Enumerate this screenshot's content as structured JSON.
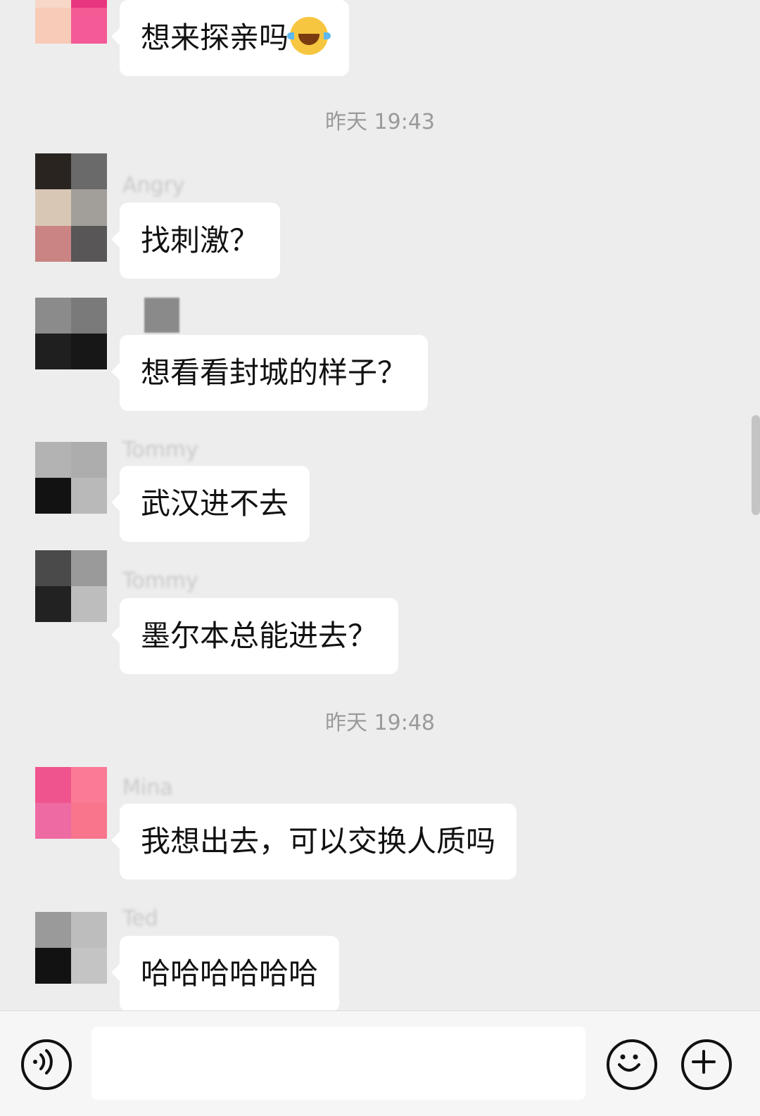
{
  "messages": [
    {
      "sender": "",
      "text": "想来探亲吗",
      "emoji": "tears-of-joy-icon"
    },
    {
      "timestamp": "昨天 19:43"
    },
    {
      "sender": "Angry",
      "text": "找刺激？"
    },
    {
      "sender": "",
      "text": "想看看封城的样子？"
    },
    {
      "sender": "Tommy",
      "text": "武汉进不去"
    },
    {
      "sender": "Tommy",
      "text": "墨尔本总能进去？"
    },
    {
      "timestamp": "昨天 19:48"
    },
    {
      "sender": "Mina",
      "text": "我想出去，可以交换人质吗"
    },
    {
      "sender": "Ted",
      "text": "哈哈哈哈哈哈"
    }
  ],
  "input_bar": {
    "voice_icon": "voice-icon",
    "emoji_icon": "emoji-icon",
    "plus_icon": "plus-icon",
    "input_value": ""
  },
  "colors": {
    "background": "#ededed",
    "bubble": "#ffffff",
    "timestamp_text": "#9a9a9a",
    "accent_pink": "#f0548f"
  }
}
